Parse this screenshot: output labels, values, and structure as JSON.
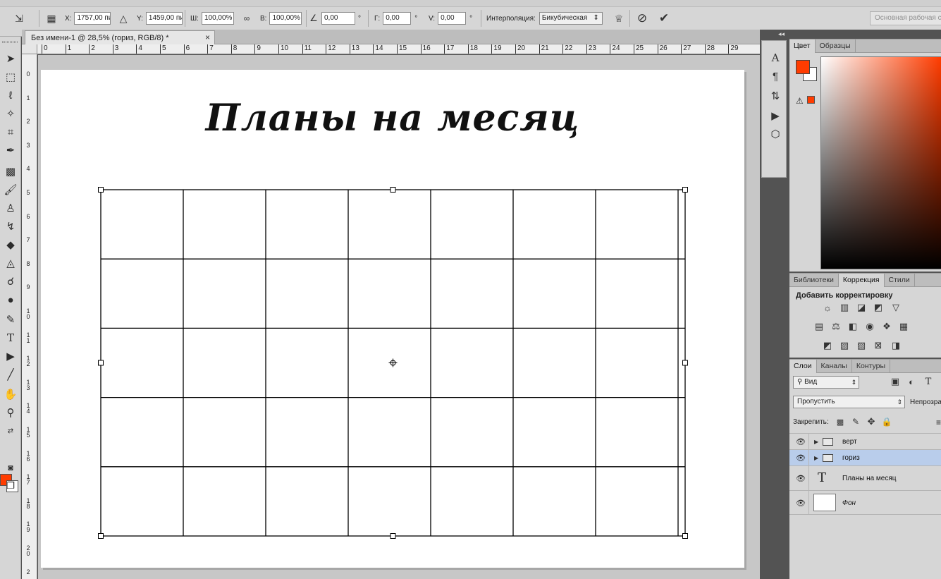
{
  "options": {
    "x_label": "X:",
    "x_value": "1757,00 пи",
    "y_label": "Y:",
    "y_value": "1459,00 пи",
    "w_label": "Ш:",
    "w_value": "100,00%",
    "h_label": "В:",
    "h_value": "100,00%",
    "angle_value": "0,00",
    "deg": "°",
    "hskew_label": "Г:",
    "hskew_value": "0,00",
    "vskew_label": "V:",
    "vskew_value": "0,00",
    "interp_label": "Интерполяция:",
    "interp_value": "Бикубическая",
    "workspace": "Основная рабочая среда"
  },
  "document": {
    "tab_title": "Без имени-1 @ 28,5% (гориз, RGB/8) *",
    "close": "×",
    "heading": "Планы на месяц"
  },
  "rulers": {
    "horizontal": [
      "0",
      "1",
      "2",
      "3",
      "4",
      "5",
      "6",
      "7",
      "8",
      "9",
      "10",
      "11",
      "12",
      "13",
      "14",
      "15",
      "16",
      "17",
      "18",
      "19",
      "20",
      "21",
      "22",
      "23",
      "24",
      "25",
      "26",
      "27",
      "28",
      "29"
    ],
    "vertical": [
      "0",
      "1",
      "2",
      "3",
      "4",
      "5",
      "6",
      "7",
      "8",
      "9",
      "10",
      "11",
      "12",
      "13",
      "14",
      "15",
      "16",
      "17",
      "18",
      "19",
      "20",
      "2"
    ]
  },
  "panels": {
    "color_tabs": [
      "Цвет",
      "Образцы"
    ],
    "adjust_tabs": [
      "Библиотеки",
      "Коррекция",
      "Стили"
    ],
    "adjust_title": "Добавить корректировку",
    "layers_tabs": [
      "Слои",
      "Каналы",
      "Контуры"
    ],
    "filter_kind": "Вид",
    "blend_mode": "Пропустить",
    "opacity_label": "Непрозрачность:",
    "lock_label": "Закрепить:",
    "layers": [
      {
        "name": "верт",
        "type": "group",
        "selected": false
      },
      {
        "name": "гориз",
        "type": "group",
        "selected": true
      },
      {
        "name": "Планы на месяц",
        "type": "text",
        "selected": false
      },
      {
        "name": "Фон",
        "type": "background",
        "selected": false
      }
    ]
  },
  "colors": {
    "foreground": "#ff3c00",
    "background": "#ffffff",
    "selected_layer": "#b9cdeb"
  },
  "grid": {
    "columns": 7,
    "rows": 5
  }
}
